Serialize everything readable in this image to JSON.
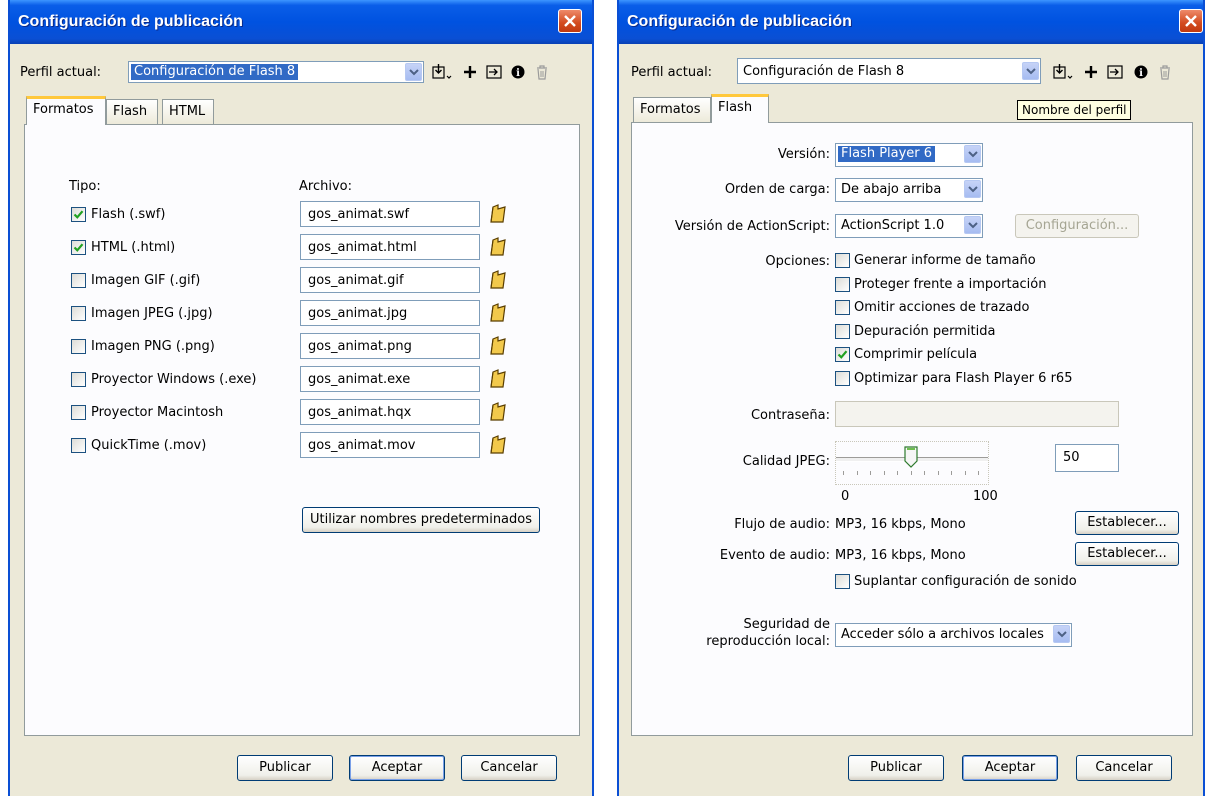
{
  "left": {
    "title": "Configuración de publicación",
    "profile_label": "Perfil actual:",
    "profile_value": "Configuración de Flash 8",
    "tabs": [
      "Formatos",
      "Flash",
      "HTML"
    ],
    "active_tab": "Formatos",
    "col_type": "Tipo:",
    "col_file": "Archivo:",
    "formats": [
      {
        "label": "Flash  (.swf)",
        "file": "gos_animat.swf",
        "checked": true
      },
      {
        "label": "HTML  (.html)",
        "file": "gos_animat.html",
        "checked": true
      },
      {
        "label": "Imagen GIF (.gif)",
        "file": "gos_animat.gif",
        "checked": false
      },
      {
        "label": "Imagen JPEG (.jpg)",
        "file": "gos_animat.jpg",
        "checked": false
      },
      {
        "label": "Imagen PNG (.png)",
        "file": "gos_animat.png",
        "checked": false
      },
      {
        "label": "Proyector Windows (.exe)",
        "file": "gos_animat.exe",
        "checked": false
      },
      {
        "label": "Proyector Macintosh",
        "file": "gos_animat.hqx",
        "checked": false
      },
      {
        "label": "QuickTime (.mov)",
        "file": "gos_animat.mov",
        "checked": false
      }
    ],
    "defaults_button": "Utilizar nombres predeterminados",
    "publish_button": "Publicar",
    "ok_button": "Aceptar",
    "cancel_button": "Cancelar"
  },
  "right": {
    "title": "Configuración de publicación",
    "profile_label": "Perfil actual:",
    "profile_value": "Configuración de Flash 8",
    "tabs": [
      "Formatos",
      "Flash"
    ],
    "active_tab": "Flash",
    "tooltip": "Nombre del perfil",
    "version_label": "Versión:",
    "version_value": "Flash Player 6",
    "load_order_label": "Orden de carga:",
    "load_order_value": "De abajo arriba",
    "as_version_label": "Versión de ActionScript:",
    "as_version_value": "ActionScript 1.0",
    "config_button": "Configuración...",
    "options_label": "Opciones:",
    "options": [
      {
        "label": "Generar informe de tamaño",
        "checked": false
      },
      {
        "label": "Proteger frente a importación",
        "checked": false
      },
      {
        "label": "Omitir acciones de trazado",
        "checked": false
      },
      {
        "label": "Depuración permitida",
        "checked": false
      },
      {
        "label": "Comprimir película",
        "checked": true
      },
      {
        "label": "Optimizar para Flash Player 6 r65",
        "checked": false
      }
    ],
    "password_label": "Contraseña:",
    "password_value": "",
    "jpeg_label": "Calidad JPEG:",
    "jpeg_value": "50",
    "jpeg_quality": 50,
    "jpeg_min": "0",
    "jpeg_max": "100",
    "audio_stream_label": "Flujo de audio:",
    "audio_stream_value": "MP3, 16 kbps, Mono",
    "audio_event_label": "Evento de audio:",
    "audio_event_value": "MP3, 16 kbps, Mono",
    "set_button": "Establecer...",
    "override_sound_label": "Suplantar configuración de sonido",
    "security_label_1": "Seguridad de",
    "security_label_2": "reproducción local:",
    "security_value": "Acceder sólo a archivos locales",
    "publish_button": "Publicar",
    "ok_button": "Aceptar",
    "cancel_button": "Cancelar"
  },
  "colors": {
    "titlebar": "#0a4fd4",
    "dialog_bg": "#ece9d8",
    "selection": "#316ac5",
    "tab_highlight": "#ffc83c",
    "close_button": "#d24a1e"
  },
  "icons": [
    "close-icon",
    "import-export-icon",
    "add-profile-icon",
    "duplicate-profile-icon",
    "profile-info-icon",
    "delete-profile-icon",
    "folder-icon",
    "chevron-down-icon",
    "check-icon"
  ]
}
